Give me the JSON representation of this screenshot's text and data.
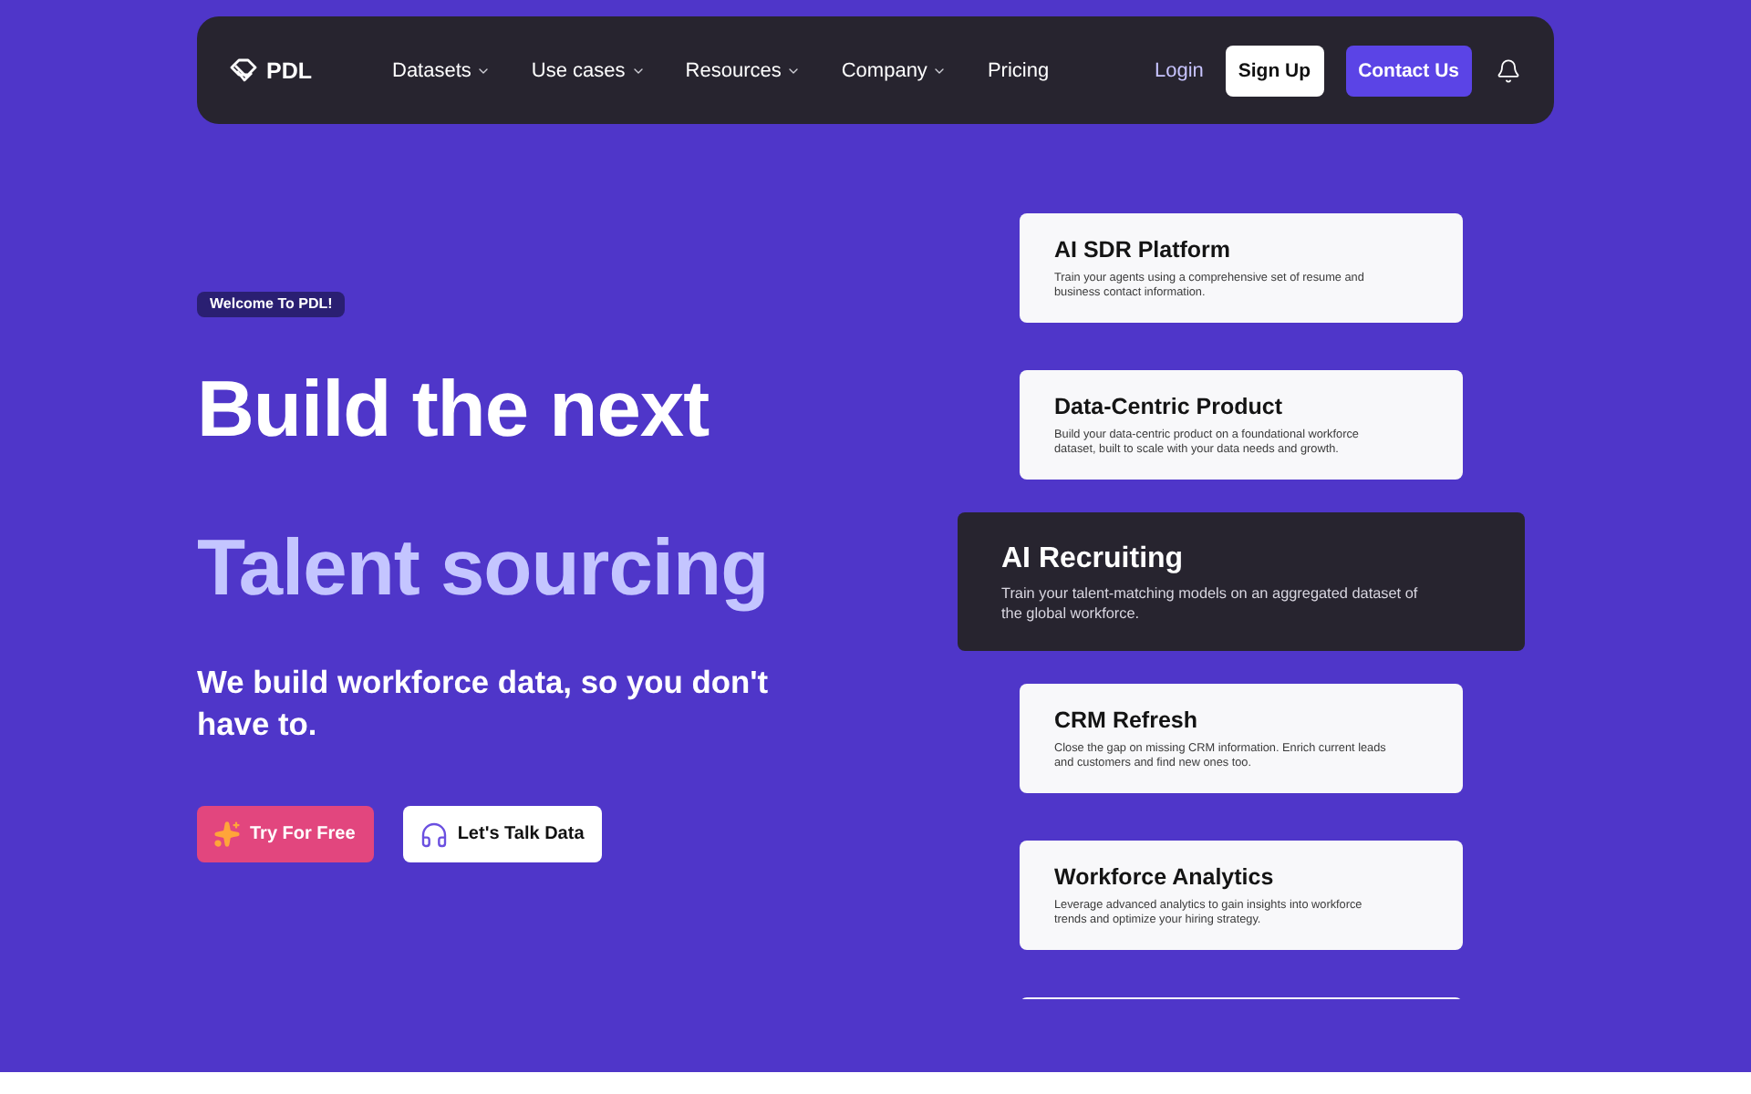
{
  "nav": {
    "logo": "PDL",
    "links": [
      {
        "label": "Datasets",
        "dropdown": true
      },
      {
        "label": "Use cases",
        "dropdown": true
      },
      {
        "label": "Resources",
        "dropdown": true
      },
      {
        "label": "Company",
        "dropdown": true
      },
      {
        "label": "Pricing",
        "dropdown": false
      }
    ],
    "login": "Login",
    "sign_up": "Sign Up",
    "contact": "Contact Us"
  },
  "hero": {
    "badge": "Welcome To PDL!",
    "headline": "Build the next",
    "rotating_text": "Talent sourcing",
    "subtitle": "We build workforce data, so you don't have to.",
    "buttons": [
      {
        "label": "Try For Free",
        "kind": "primary"
      },
      {
        "label": "Let's Talk Data",
        "kind": "secondary"
      }
    ]
  },
  "use_cases": [
    {
      "title": "AI SDR Platform",
      "description": "Train your agents using a comprehensive set of resume and business contact information.",
      "selected": false
    },
    {
      "title": "Data-Centric Product",
      "description": "Build your data-centric product on a foundational workforce dataset, built to scale with your data needs and growth.",
      "selected": false
    },
    {
      "title": "AI Recruiting",
      "description": "Train your talent-matching models on an aggregated dataset of the global workforce.",
      "selected": true
    },
    {
      "title": "CRM Refresh",
      "description": "Close the gap on missing CRM information. Enrich current leads and customers and find new ones too.",
      "selected": false
    },
    {
      "title": "Workforce Analytics",
      "description": "Leverage advanced analytics to gain insights into workforce trends and optimize your hiring strategy.",
      "selected": false
    }
  ]
}
